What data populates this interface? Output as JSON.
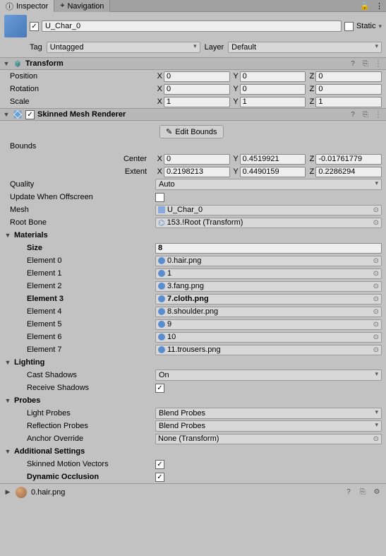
{
  "tabs": {
    "inspector": "Inspector",
    "navigation": "Navigation"
  },
  "header": {
    "name": "U_Char_0",
    "static_label": "Static",
    "tag_label": "Tag",
    "tag_value": "Untagged",
    "layer_label": "Layer",
    "layer_value": "Default"
  },
  "transform": {
    "title": "Transform",
    "position_label": "Position",
    "rotation_label": "Rotation",
    "scale_label": "Scale",
    "position": {
      "x": "0",
      "y": "0",
      "z": "0"
    },
    "rotation": {
      "x": "0",
      "y": "0",
      "z": "0"
    },
    "scale": {
      "x": "1",
      "y": "1",
      "z": "1"
    }
  },
  "smr": {
    "title": "Skinned Mesh Renderer",
    "edit_bounds": "Edit Bounds",
    "bounds_label": "Bounds",
    "center_label": "Center",
    "extent_label": "Extent",
    "center": {
      "x": "0",
      "y": "0.4519921",
      "z": "-0.01761779"
    },
    "extent": {
      "x": "0.2198213",
      "y": "0.4490159",
      "z": "0.2286294"
    },
    "quality_label": "Quality",
    "quality_value": "Auto",
    "update_label": "Update When Offscreen",
    "mesh_label": "Mesh",
    "mesh_value": "U_Char_0",
    "rootbone_label": "Root Bone",
    "rootbone_value": "153.!Root (Transform)",
    "materials_label": "Materials",
    "size_label": "Size",
    "size_value": "8",
    "elements": [
      {
        "label": "Element 0",
        "value": "0.hair.png"
      },
      {
        "label": "Element 1",
        "value": "1"
      },
      {
        "label": "Element 2",
        "value": "3.fang.png"
      },
      {
        "label": "Element 3",
        "value": "7.cloth.png"
      },
      {
        "label": "Element 4",
        "value": "8.shoulder.png"
      },
      {
        "label": "Element 5",
        "value": "9"
      },
      {
        "label": "Element 6",
        "value": "10"
      },
      {
        "label": "Element 7",
        "value": "11.trousers.png"
      }
    ],
    "lighting_label": "Lighting",
    "cast_label": "Cast Shadows",
    "cast_value": "On",
    "receive_label": "Receive Shadows",
    "probes_label": "Probes",
    "lightprobes_label": "Light Probes",
    "lightprobes_value": "Blend Probes",
    "reflprobes_label": "Reflection Probes",
    "reflprobes_value": "Blend Probes",
    "anchor_label": "Anchor Override",
    "anchor_value": "None (Transform)",
    "additional_label": "Additional Settings",
    "smv_label": "Skinned Motion Vectors",
    "dynocc_label": "Dynamic Occlusion"
  },
  "footer": {
    "material": "0.hair.png"
  }
}
